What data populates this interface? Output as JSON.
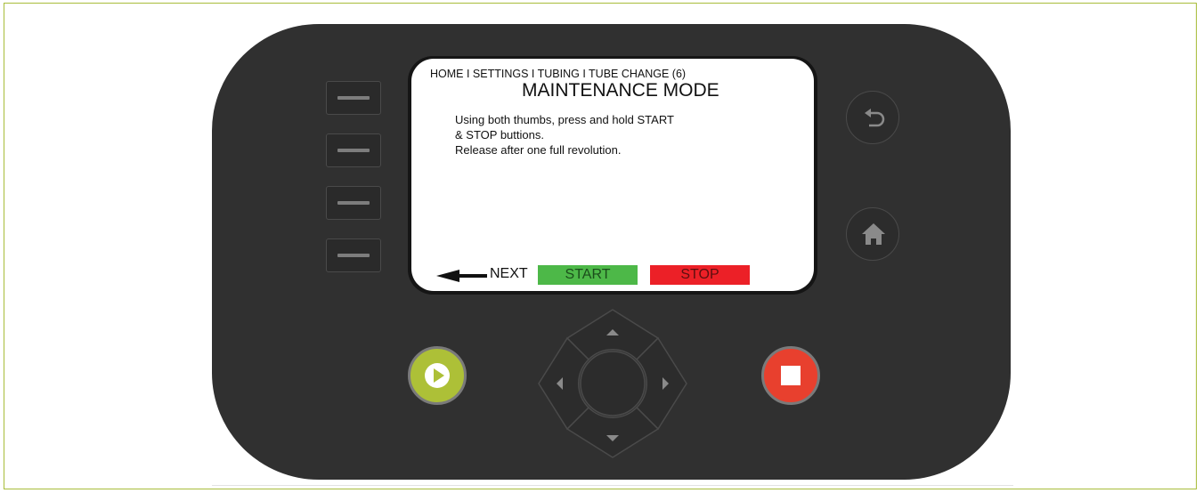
{
  "screen": {
    "breadcrumb": "HOME I SETTINGS I TUBING I TUBE CHANGE (6)",
    "title": "MAINTENANCE MODE",
    "instructions": [
      "Using both thumbs, press and hold START",
      "& STOP buttions.",
      "Release after one full revolution."
    ],
    "next_label": "NEXT",
    "start_label": "START",
    "stop_label": "STOP"
  },
  "icons": {
    "soft_keys": [
      "dash-icon",
      "dash-icon",
      "dash-icon",
      "dash-icon"
    ],
    "back": "back-arrow-icon",
    "home": "home-icon",
    "play": "play-icon",
    "stop": "stop-square-icon",
    "dpad": [
      "chevron-up-icon",
      "chevron-down-icon",
      "chevron-left-icon",
      "chevron-right-icon"
    ]
  },
  "colors": {
    "device_body": "#303030",
    "frame_border": "#a8bd3a",
    "start_green": "#4db848",
    "stop_red": "#ec2027",
    "play_button": "#adc037",
    "stop_button": "#e8402e"
  }
}
